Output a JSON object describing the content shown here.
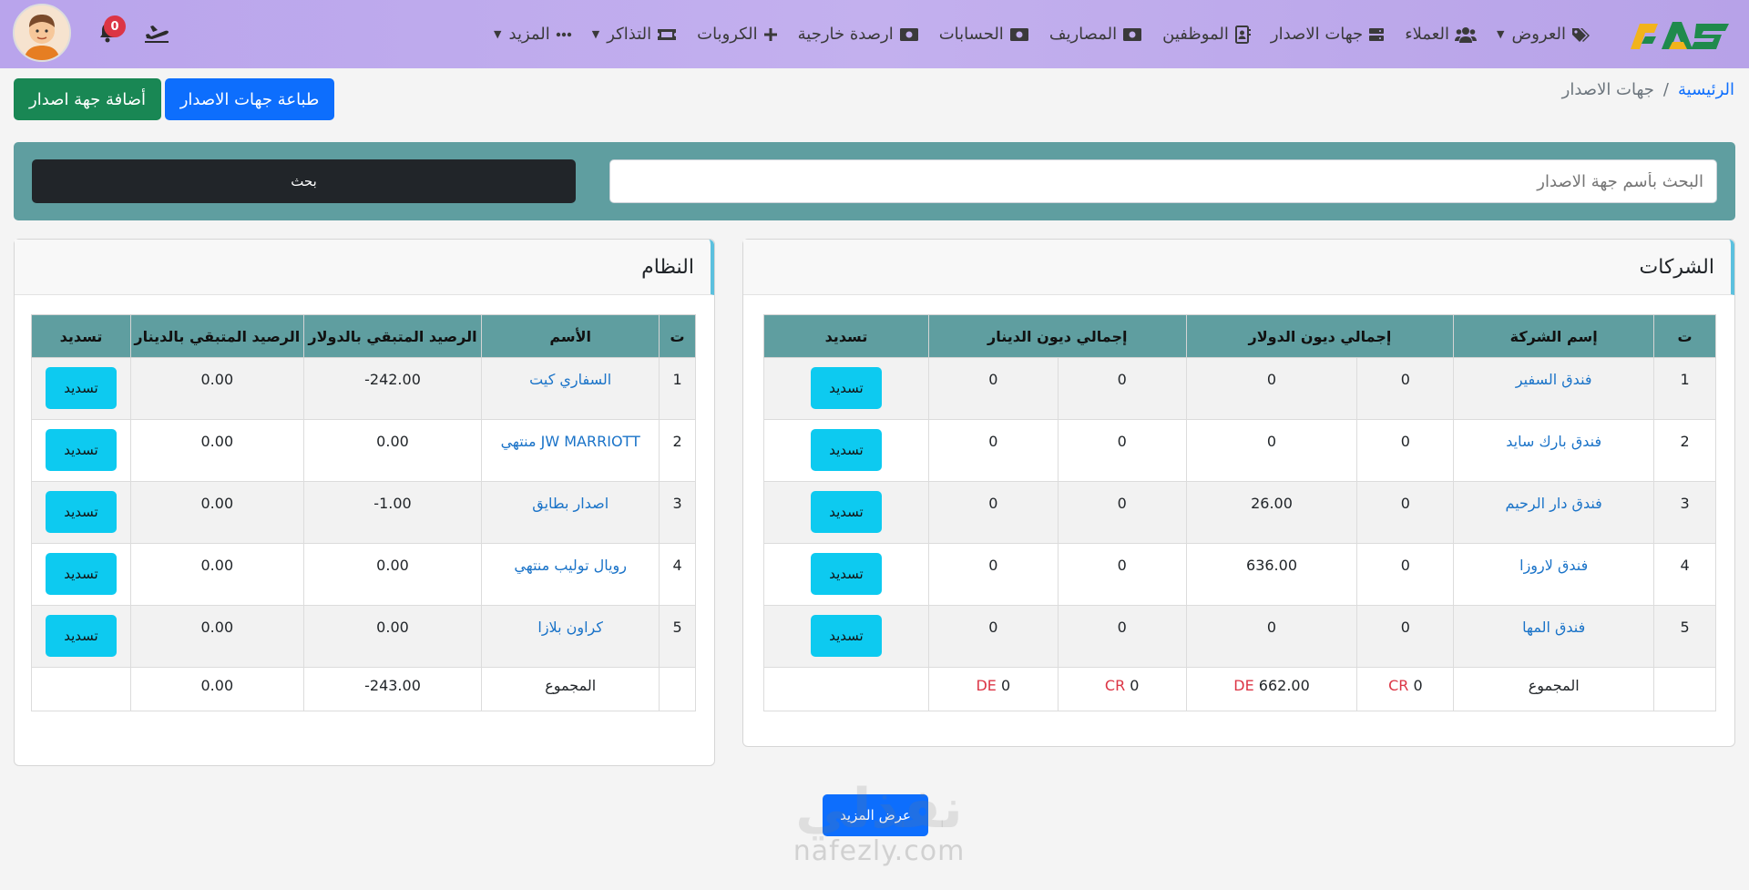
{
  "nav": {
    "items": [
      {
        "label": "العروض",
        "icon": "tags-icon",
        "dropdown": true
      },
      {
        "label": "العملاء",
        "icon": "users-icon",
        "dropdown": false
      },
      {
        "label": "جهات الاصدار",
        "icon": "server-icon",
        "dropdown": false
      },
      {
        "label": "الموظفين",
        "icon": "address-book-icon",
        "dropdown": false
      },
      {
        "label": "المصاريف",
        "icon": "money-bill-icon",
        "dropdown": false
      },
      {
        "label": "الحسابات",
        "icon": "money-bill-icon",
        "dropdown": false
      },
      {
        "label": "ارصدة خارجية",
        "icon": "money-bill-icon",
        "dropdown": false
      },
      {
        "label": "الكروبات",
        "icon": "plus-icon",
        "dropdown": false
      },
      {
        "label": "التذاكر",
        "icon": "ticket-icon",
        "dropdown": true
      },
      {
        "label": "المزيد",
        "icon": "ellipsis-icon",
        "dropdown": true
      }
    ],
    "notifications_count": "0"
  },
  "breadcrumb": {
    "home": "الرئيسية",
    "separator": "/",
    "current": "جهات الاصدار"
  },
  "actions": {
    "add_label": "أضافة جهة اصدار",
    "print_label": "طباعة جهات الاصدار"
  },
  "search": {
    "placeholder": "البحث بأسم جهة الاصدار",
    "button_label": "بحث"
  },
  "companies": {
    "title": "الشركات",
    "headers": {
      "index": "ت",
      "name": "إسم الشركة",
      "usd": "إجمالي ديون الدولار",
      "iqd": "إجمالي ديون الدينار",
      "pay": "تسديد"
    },
    "rows": [
      {
        "idx": "1",
        "name": "فندق السفير",
        "usd_cr": "0",
        "usd_de": "0",
        "iqd_cr": "0",
        "iqd_de": "0",
        "pay": "تسديد"
      },
      {
        "idx": "2",
        "name": "فندق بارك سايد",
        "usd_cr": "0",
        "usd_de": "0",
        "iqd_cr": "0",
        "iqd_de": "0",
        "pay": "تسديد"
      },
      {
        "idx": "3",
        "name": "فندق دار الرحيم",
        "usd_cr": "0",
        "usd_de": "26.00",
        "iqd_cr": "0",
        "iqd_de": "0",
        "pay": "تسديد"
      },
      {
        "idx": "4",
        "name": "فندق لاروزا",
        "usd_cr": "0",
        "usd_de": "636.00",
        "iqd_cr": "0",
        "iqd_de": "0",
        "pay": "تسديد"
      },
      {
        "idx": "5",
        "name": "فندق المها",
        "usd_cr": "0",
        "usd_de": "0",
        "iqd_cr": "0",
        "iqd_de": "0",
        "pay": "تسديد"
      }
    ],
    "total": {
      "label": "المجموع",
      "usd_cr": "0",
      "usd_de": "662.00",
      "iqd_cr": "0",
      "iqd_de": "0",
      "cr_tag": "CR",
      "de_tag": "DE"
    }
  },
  "system": {
    "title": "النظام",
    "headers": {
      "index": "ت",
      "name": "الأسم",
      "usd": "الرصيد المتبقي بالدولار",
      "iqd": "الرصيد المتبقي بالدينار",
      "pay": "تسديد"
    },
    "rows": [
      {
        "idx": "1",
        "name": "السفاري كيت",
        "usd": "242.00-",
        "iqd": "0.00",
        "pay": "تسديد"
      },
      {
        "idx": "2",
        "name": "JW MARRIOTT منتهي",
        "usd": "0.00",
        "iqd": "0.00",
        "pay": "تسديد"
      },
      {
        "idx": "3",
        "name": "اصدار بطايق",
        "usd": "1.00-",
        "iqd": "0.00",
        "pay": "تسديد"
      },
      {
        "idx": "4",
        "name": "رويال توليب منتهي",
        "usd": "0.00",
        "iqd": "0.00",
        "pay": "تسديد"
      },
      {
        "idx": "5",
        "name": "كراون بلازا",
        "usd": "0.00",
        "iqd": "0.00",
        "pay": "تسديد"
      }
    ],
    "total": {
      "label": "المجموع",
      "usd": "243.00-",
      "iqd": "0.00"
    }
  },
  "more_label": "عرض المزيد",
  "watermark": {
    "ar": "نفذلي",
    "en": "nafezly.com"
  },
  "colors": {
    "nav_bg": "#b9a4ec",
    "panel": "#5f9ea0",
    "green": "#198754",
    "blue": "#0d6efd",
    "cyan": "#0dcaf0",
    "link": "#1a73c8",
    "danger": "#dc3545"
  }
}
